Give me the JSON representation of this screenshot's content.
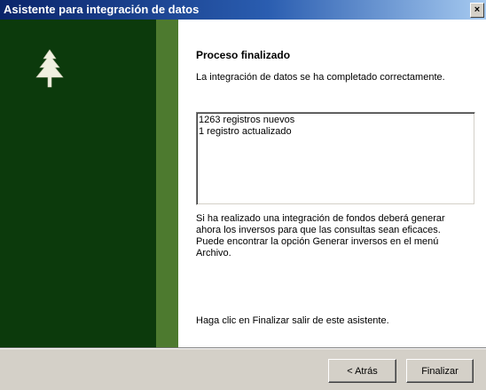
{
  "window": {
    "title": "Asistente para integración de datos",
    "close_glyph": "×"
  },
  "page": {
    "heading": "Proceso finalizado",
    "intro": "La integración de datos se ha completado correctamente.",
    "results": [
      "1263 registros nuevos",
      "1 registro actualizado"
    ],
    "note": "Si ha realizado una integración de fondos deberá generar ahora los inversos para que las consultas sean eficaces. Puede encontrar la opción Generar inversos en el menú Archivo.",
    "finish_hint": "Haga clic en Finalizar salir de este asistente."
  },
  "buttons": {
    "back_label": "< Atrás",
    "finish_label": "Finalizar"
  },
  "colors": {
    "titlebar_start": "#0a246a",
    "banner_dark": "#0c3a0c",
    "banner_light": "#4d7a2f",
    "dialog_face": "#d4d0c8"
  },
  "icons": {
    "logo": "tree-icon"
  }
}
